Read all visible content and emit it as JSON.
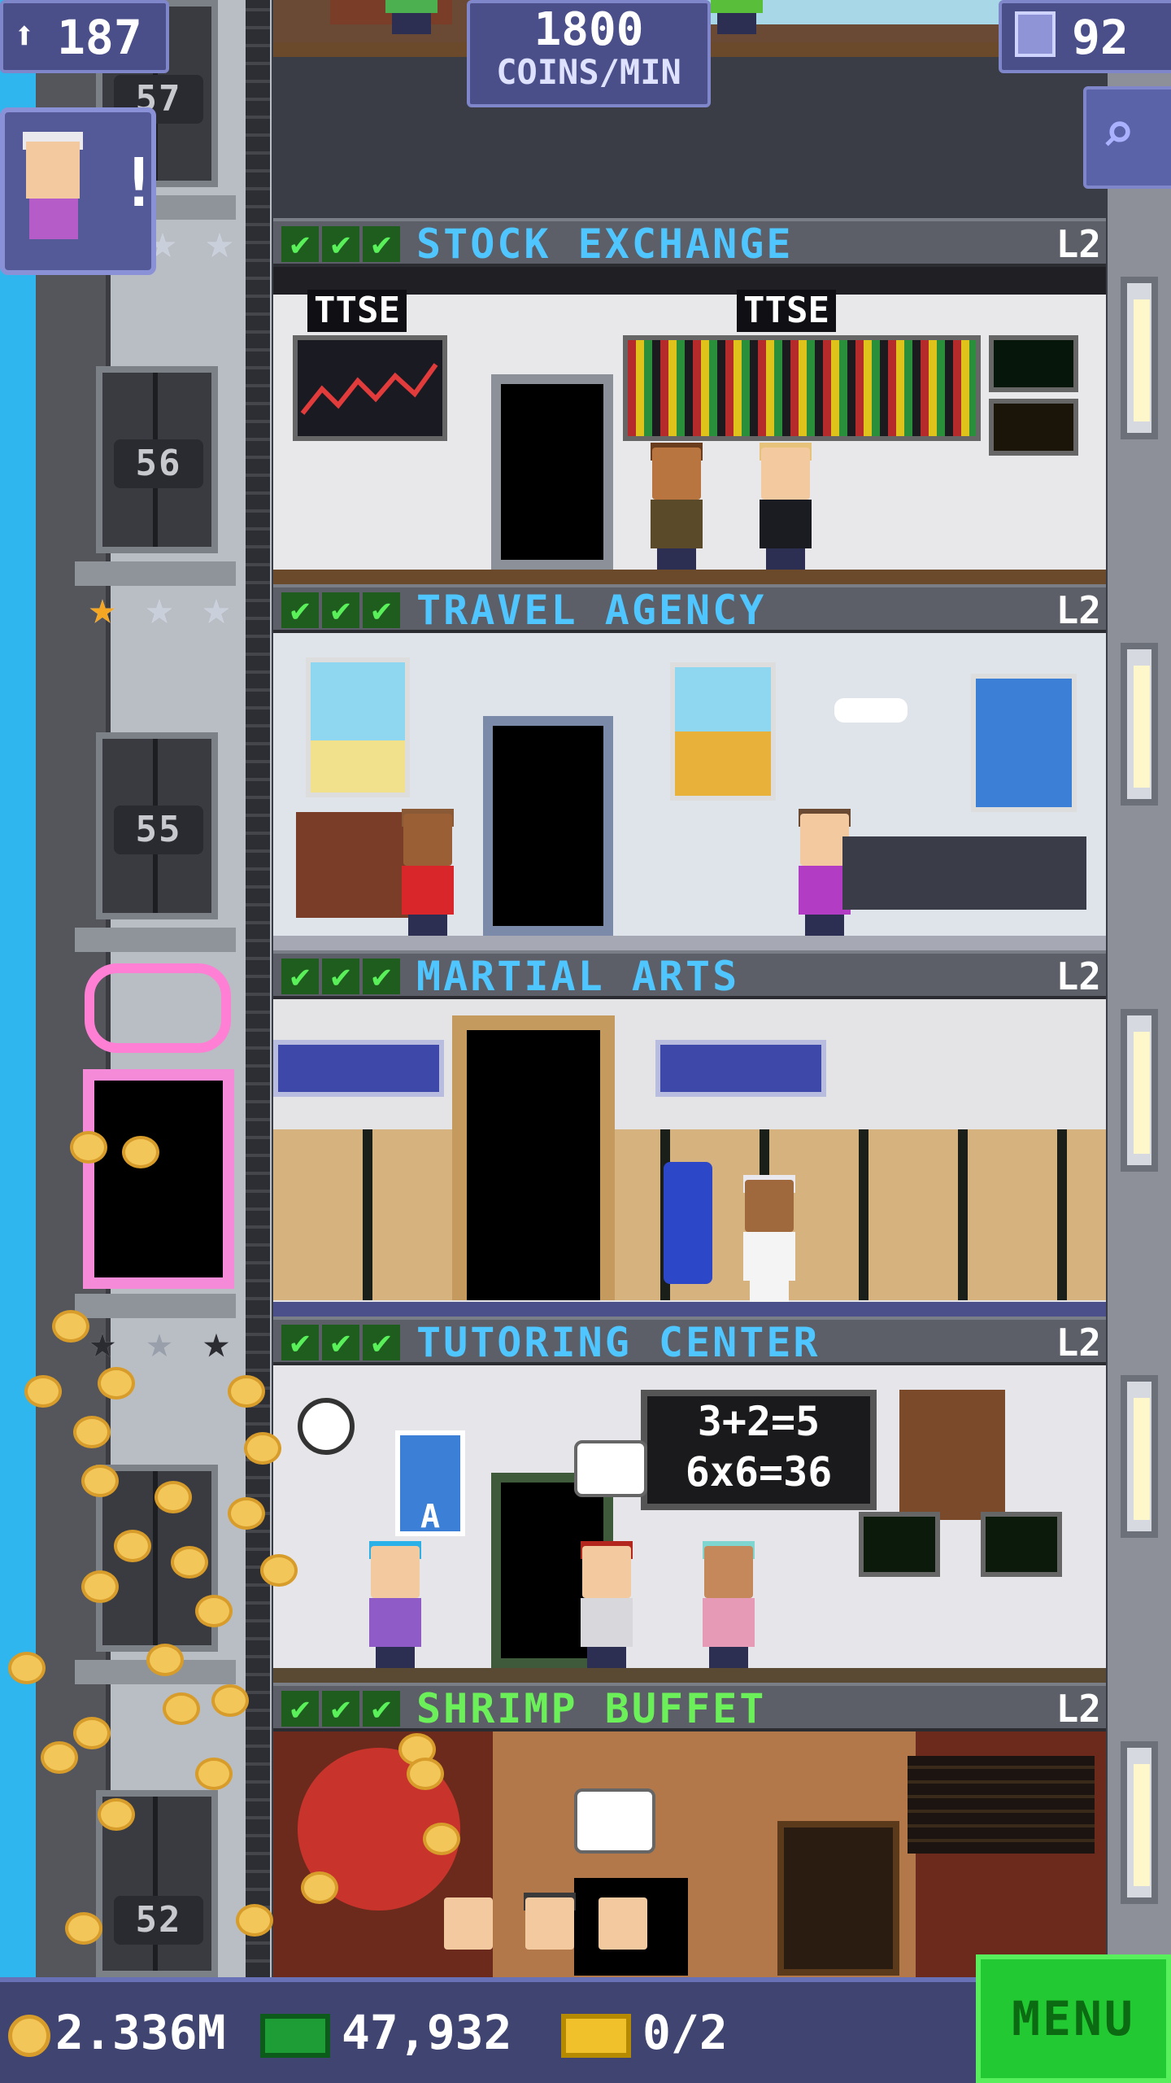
{
  "hud": {
    "population": "187",
    "coins_rate_value": "1800",
    "coins_rate_unit": "COINS/MIN",
    "floors_count": "92",
    "icons": {
      "population": "person-icon",
      "floors": "building-icon",
      "zoom": "magnifier-icon"
    }
  },
  "elevator": {
    "floor_numbers": [
      "57",
      "56",
      "55",
      "52"
    ]
  },
  "floors": [
    {
      "name": "STOCK EXCHANGE",
      "level": "L2",
      "name_color": "#4fc6ff",
      "checks": [
        "✔",
        "✔",
        "✔"
      ],
      "stars": [
        "silver",
        "silver"
      ],
      "signs": [
        "TTSE",
        "TTSE"
      ]
    },
    {
      "name": "TRAVEL AGENCY",
      "level": "L2",
      "name_color": "#4fc6ff",
      "checks": [
        "✔",
        "✔",
        "✔"
      ],
      "stars": [
        "gold",
        "silver",
        "silver"
      ]
    },
    {
      "name": "MARTIAL ARTS",
      "level": "L2",
      "name_color": "#4fc6ff",
      "checks": [
        "✔",
        "✔",
        "✔"
      ],
      "stars": []
    },
    {
      "name": "TUTORING CENTER",
      "level": "L2",
      "name_color": "#4fc6ff",
      "checks": [
        "✔",
        "✔",
        "✔"
      ],
      "stars": [],
      "board_line1": "3+2=5",
      "board_line2": "6x6=36",
      "apple_poster": "A"
    },
    {
      "name": "SHRIMP BUFFET",
      "level": "L2",
      "name_color": "#6cf05a",
      "checks": [
        "✔",
        "✔",
        "✔"
      ],
      "stars": []
    }
  ],
  "bottom_bar": {
    "coins": "2.336M",
    "bux": "47,932",
    "tickets": "0/2",
    "menu_label": "MENU"
  },
  "colors": {
    "accent_green": "#22c933",
    "hud_blue": "#4a4f8a",
    "sky": "#2fb6ee"
  }
}
